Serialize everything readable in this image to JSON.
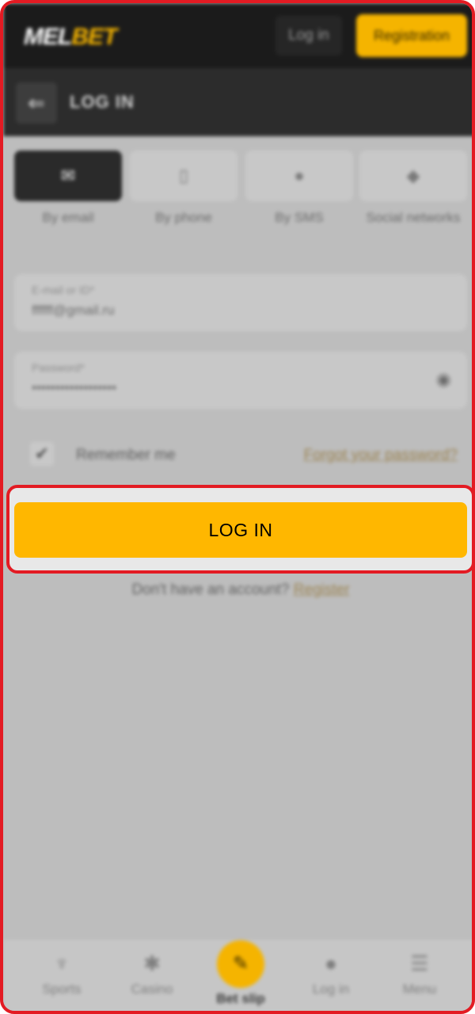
{
  "topbar": {
    "logo_part1": "MEL",
    "logo_part2": "BET",
    "login_label": "Log in",
    "registration_label": "Registration"
  },
  "header": {
    "back_glyph": "⇐",
    "title": "LOG IN"
  },
  "tabs": [
    {
      "label": "By email",
      "icon": "✉",
      "icon_name": "envelope-icon",
      "active": true
    },
    {
      "label": "By phone",
      "icon": "▯",
      "icon_name": "phone-icon",
      "active": false
    },
    {
      "label": "By SMS",
      "icon": "●",
      "icon_name": "chat-bubble-icon",
      "active": false
    },
    {
      "label": "Social networks",
      "icon": "◆",
      "icon_name": "social-icon",
      "active": false
    }
  ],
  "form": {
    "email_label": "E-mail or ID*",
    "email_value": "ffffff@gmail.ru",
    "password_label": "Password*",
    "password_value": "••••••••••••••••••",
    "eye_glyph": "◉",
    "remember_check": "✔",
    "remember_label": "Remember me",
    "forgot_label": "Forgot your password?",
    "submit_label": "LOG IN",
    "no_account": "Don't have an account?",
    "register_link": "Register"
  },
  "bottom_nav": [
    {
      "label": "Sports",
      "icon": "♆",
      "icon_name": "trophy-icon"
    },
    {
      "label": "Casino",
      "icon": "✱",
      "icon_name": "casino-chip-icon"
    },
    {
      "label": "Bet slip",
      "icon": "✎",
      "icon_name": "ticket-icon"
    },
    {
      "label": "Log in",
      "icon": "●",
      "icon_name": "user-icon"
    },
    {
      "label": "Menu",
      "icon": "☰",
      "icon_name": "menu-icon"
    }
  ],
  "colors": {
    "accent": "#ffb700",
    "highlight_border": "#e31b23",
    "topbar_bg": "#1b1b1b",
    "header_bg": "#2c2c2c"
  }
}
